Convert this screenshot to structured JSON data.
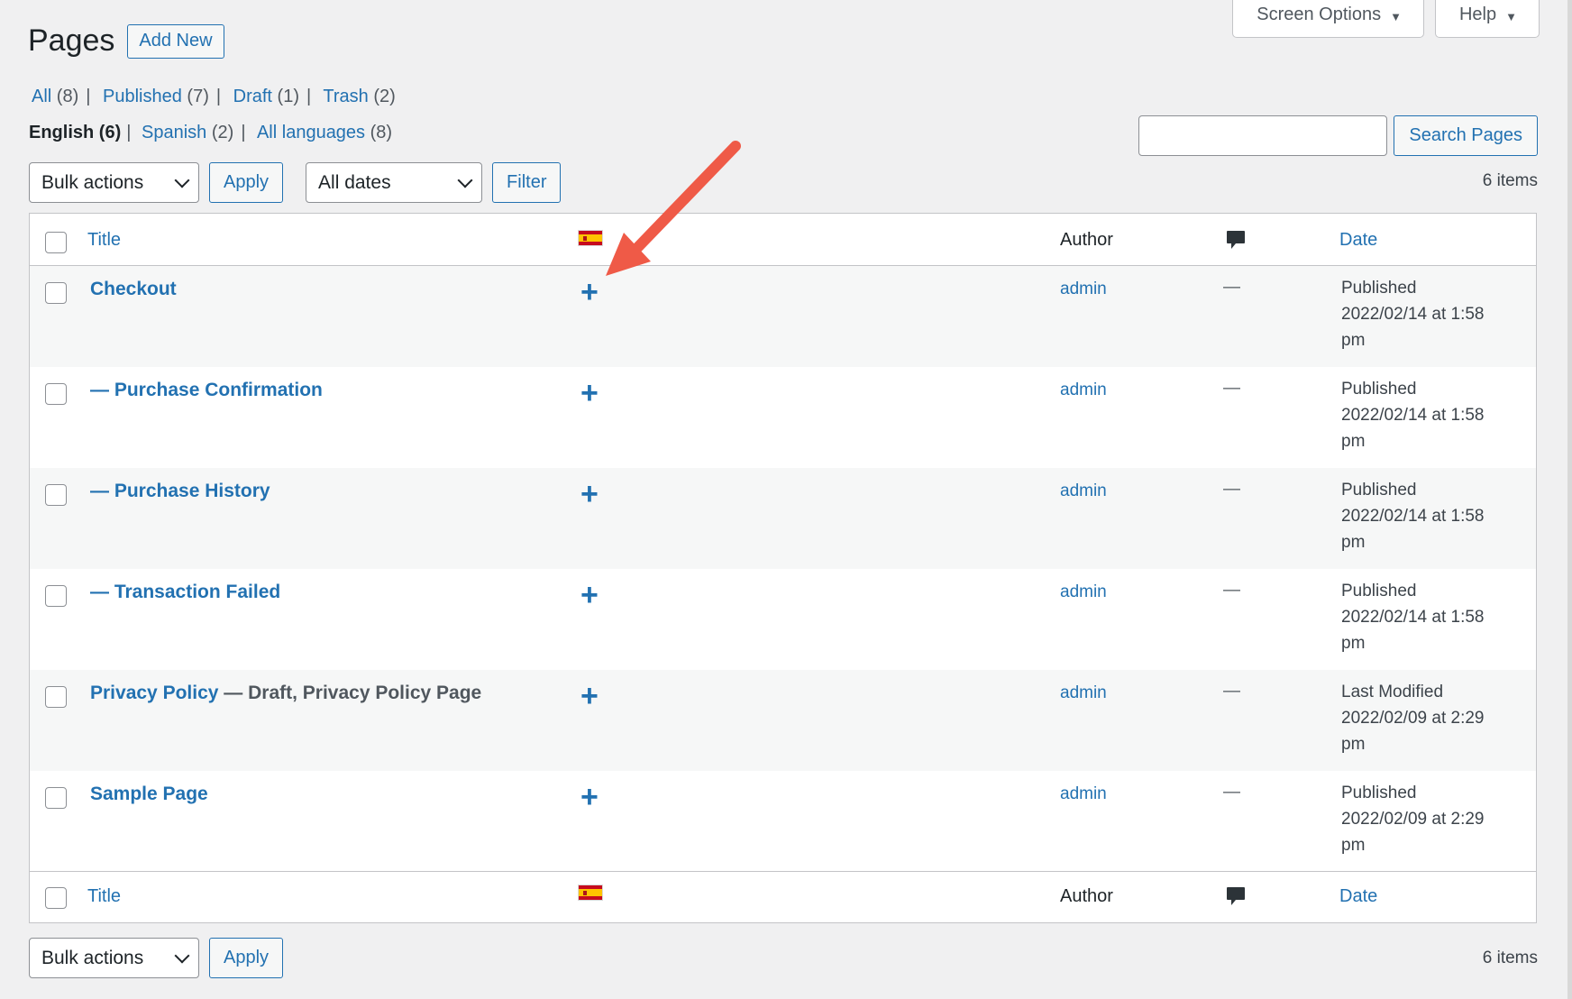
{
  "header": {
    "title": "Pages",
    "add_new": "Add New",
    "screen_options": "Screen Options",
    "help": "Help"
  },
  "status_filters": [
    {
      "label": "All",
      "count": "(8)"
    },
    {
      "label": "Published",
      "count": "(7)"
    },
    {
      "label": "Draft",
      "count": "(1)"
    },
    {
      "label": "Trash",
      "count": "(2)"
    }
  ],
  "language_filters": [
    {
      "label": "English",
      "count": "(6)",
      "current": true
    },
    {
      "label": "Spanish",
      "count": "(2)"
    },
    {
      "label": "All languages",
      "count": "(8)"
    }
  ],
  "search": {
    "button": "Search Pages",
    "value": ""
  },
  "tablenav_top": {
    "bulk_actions": "Bulk actions",
    "apply": "Apply",
    "dates": "All dates",
    "filter": "Filter",
    "items": "6 items"
  },
  "tablenav_bottom": {
    "bulk_actions": "Bulk actions",
    "apply": "Apply",
    "items": "6 items"
  },
  "columns": {
    "title": "Title",
    "language_icon": "spain-flag-icon",
    "author": "Author",
    "comments_icon": "comment-icon",
    "date": "Date"
  },
  "rows": [
    {
      "title": "Checkout",
      "state": "",
      "author": "admin",
      "comments": "—",
      "date_status": "Published",
      "date": "2022/02/14 at 1:58",
      "date_suffix": "pm"
    },
    {
      "title": "— Purchase Confirmation",
      "state": "",
      "author": "admin",
      "comments": "—",
      "date_status": "Published",
      "date": "2022/02/14 at 1:58",
      "date_suffix": "pm"
    },
    {
      "title": "— Purchase History",
      "state": "",
      "author": "admin",
      "comments": "—",
      "date_status": "Published",
      "date": "2022/02/14 at 1:58",
      "date_suffix": "pm"
    },
    {
      "title": "— Transaction Failed",
      "state": "",
      "author": "admin",
      "comments": "—",
      "date_status": "Published",
      "date": "2022/02/14 at 1:58",
      "date_suffix": "pm"
    },
    {
      "title": "Privacy Policy",
      "state": " — Draft, Privacy Policy Page",
      "author": "admin",
      "comments": "—",
      "date_status": "Last Modified",
      "date": "2022/02/09 at 2:29",
      "date_suffix": "pm"
    },
    {
      "title": "Sample Page",
      "state": "",
      "author": "admin",
      "comments": "—",
      "date_status": "Published",
      "date": "2022/02/09 at 2:29",
      "date_suffix": "pm"
    }
  ],
  "colors": {
    "link": "#2271b1",
    "background": "#f0f0f1",
    "annotation_arrow": "#ef5a47"
  }
}
